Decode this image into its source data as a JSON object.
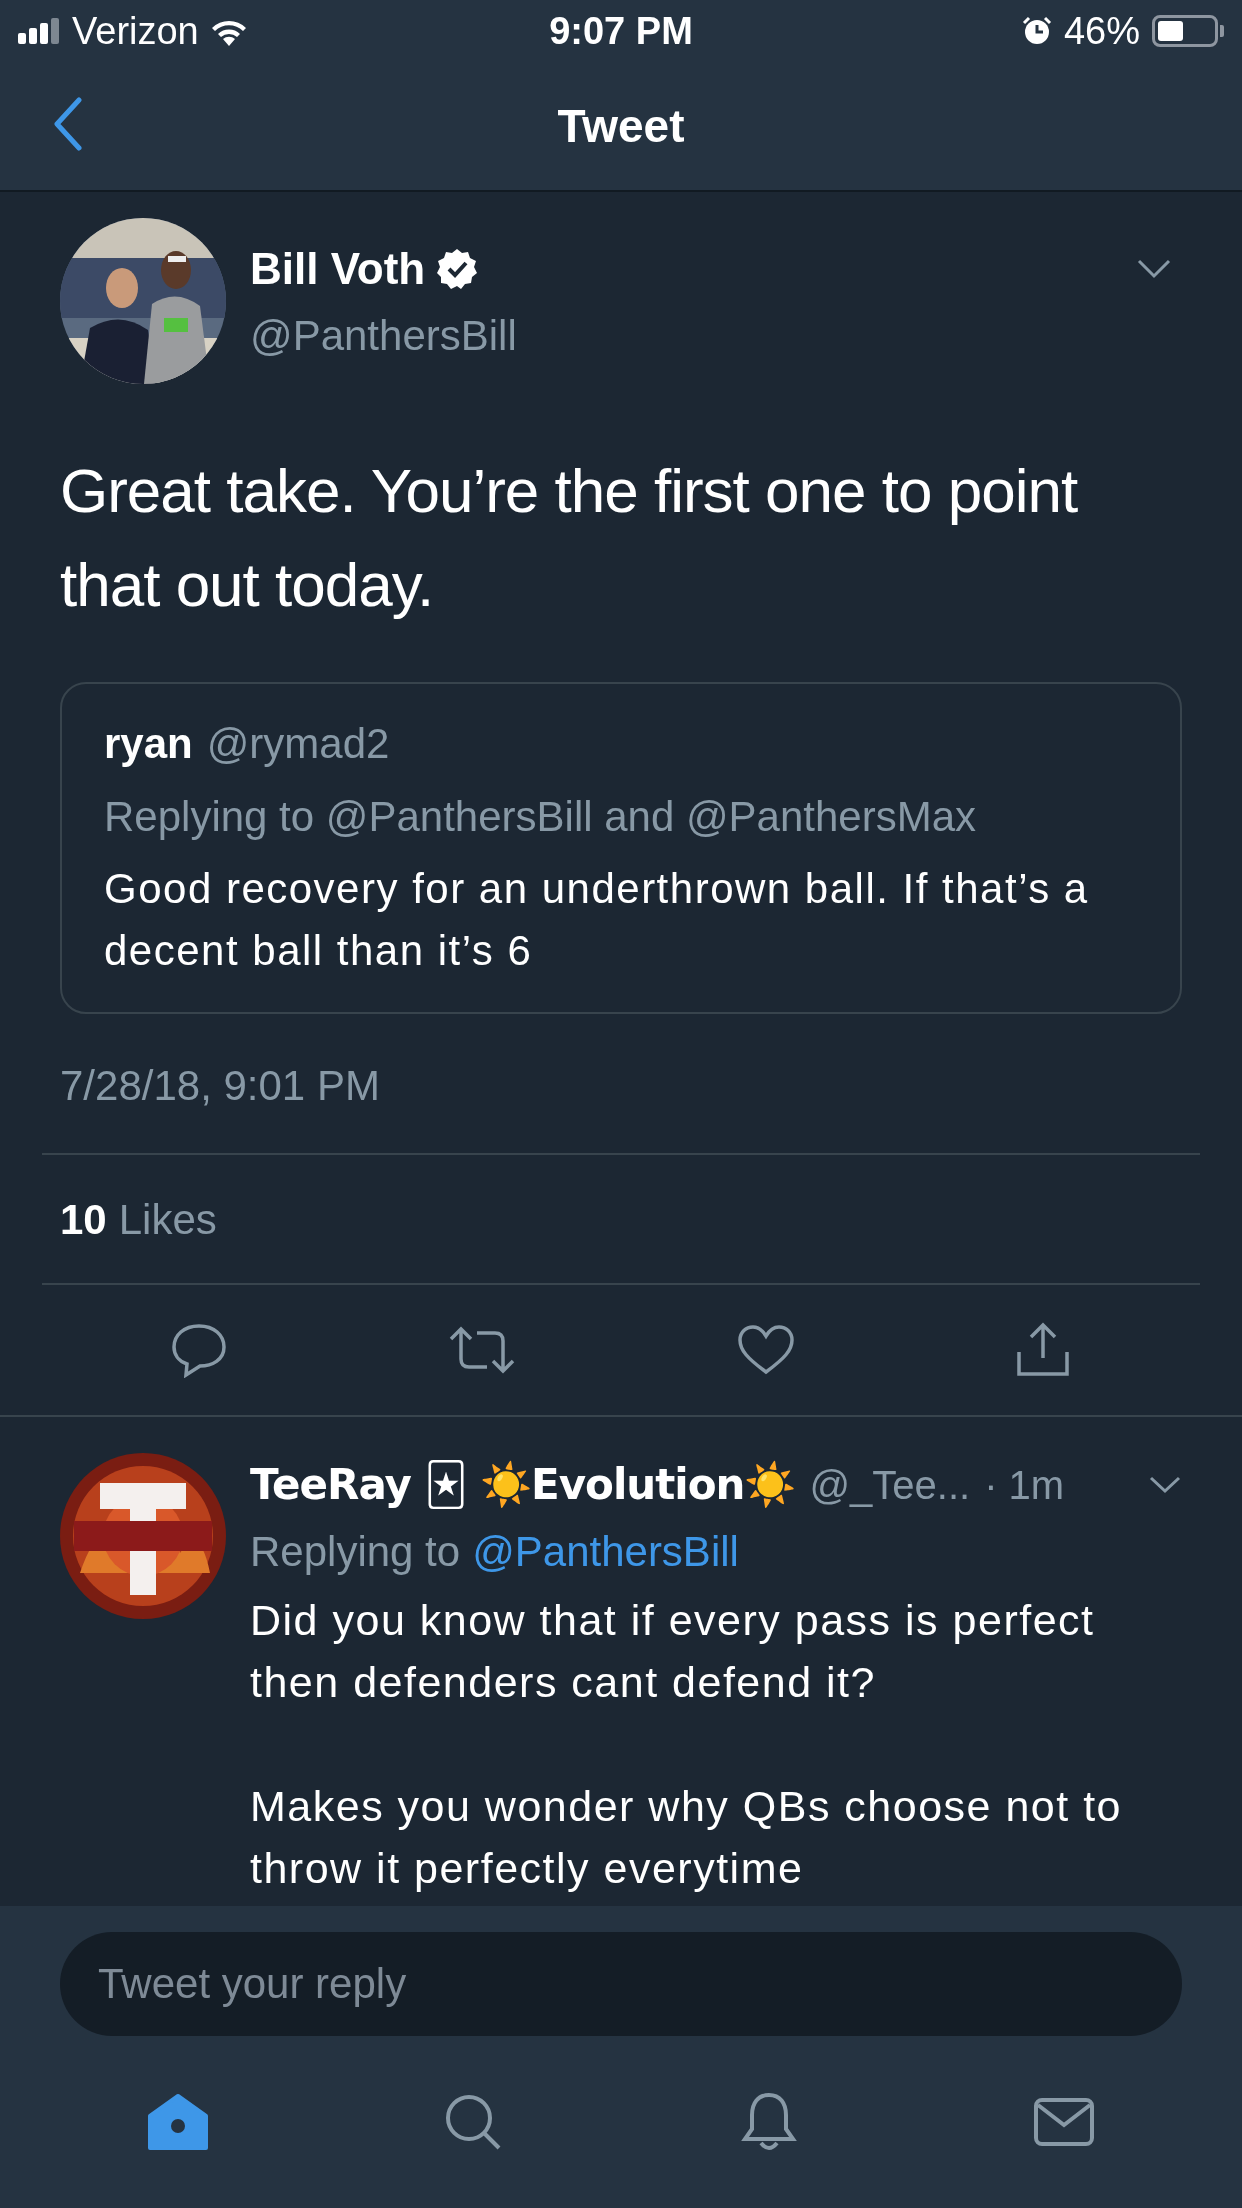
{
  "status_bar": {
    "carrier": "Verizon",
    "time": "9:07 PM",
    "battery": "46%"
  },
  "nav": {
    "title": "Tweet"
  },
  "tweet": {
    "name": "Bill Voth",
    "verified": true,
    "handle": "@PanthersBill",
    "text": "Great take. You’re the first one to point that out today.",
    "quote": {
      "name": "ryan",
      "handle": "@rymad2",
      "replying": "Replying to @PanthersBill and @PanthersMax",
      "text": "Good recovery for an underthrown ball. If that’s a decent ball than it’s 6"
    },
    "date": "7/28/18, 9:01 PM",
    "likes_count": "10",
    "likes_label": "Likes"
  },
  "replies": [
    {
      "name": "TeeRay 🃏 ☀️Evolution☀️",
      "handle": "@_Tee...",
      "time": "· 1m",
      "replying_prefix": "Replying to",
      "replying_to": "@PanthersBill",
      "paragraphs": [
        "Did you know that if every pass is perfect then defenders cant defend it?",
        "Makes you wonder why QBs choose not to throw it perfectly everytime"
      ]
    }
  ],
  "composer": {
    "placeholder": "Tweet your reply"
  },
  "tabs": [
    {
      "kind": "home",
      "selected": true
    },
    {
      "kind": "search",
      "selected": false
    },
    {
      "kind": "notifications",
      "selected": false
    },
    {
      "kind": "messages",
      "selected": false
    }
  ]
}
